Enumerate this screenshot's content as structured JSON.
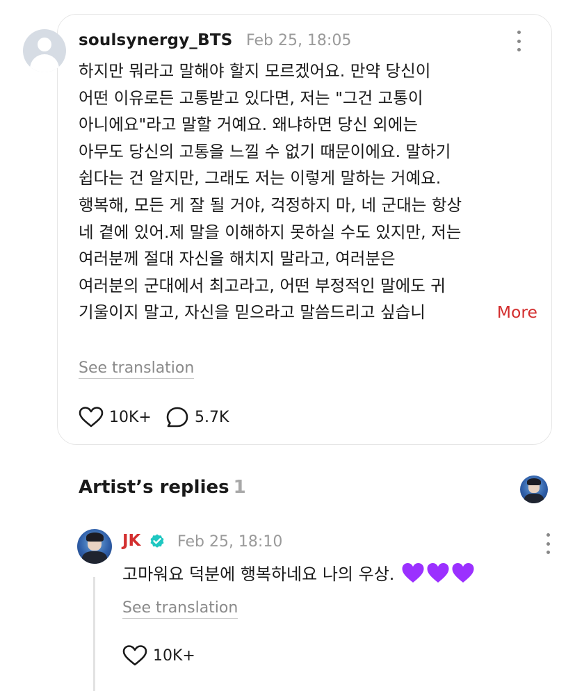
{
  "post": {
    "username": "soulsynergy_BTS",
    "timestamp": "Feb 25, 18:05",
    "lines": [
      "하지만 뭐라고 말해야 할지 모르겠어요. 만약 당신이",
      "어떤 이유로든 고통받고 있다면, 저는 \"그건 고통이",
      "아니에요\"라고 말할 거예요. 왜냐하면 당신 외에는",
      "아무도 당신의 고통을 느낄 수 없기 때문이에요. 말하기",
      "쉽다는 건 알지만, 그래도 저는 이렇게 말하는 거예요.",
      "행복해, 모든 게 잘 될 거야, 걱정하지 마, 네 군대는 항상",
      "네 곁에 있어.제 말을 이해하지 못하실 수도 있지만, 저는",
      "여러분께 절대 자신을 해치지 말라고, 여러분은",
      "여러분의 군대에서 최고라고, 어떤 부정적인 말에도 귀",
      "기울이지 말고, 자신을 믿으라고 말씀드리고 싶습니"
    ],
    "more_label": "More",
    "see_translation": "See translation",
    "likes": "10K+",
    "comments": "5.7K"
  },
  "replies_section": {
    "title": "Artist’s replies",
    "count": "1"
  },
  "reply": {
    "name": "JK",
    "timestamp": "Feb 25, 18:10",
    "text": "고마워요 덕분에 행복하네요 나의 우상.",
    "emoji_hearts": 3,
    "see_translation": "See translation",
    "likes": "10K+"
  },
  "colors": {
    "accent_red": "#d32f2f",
    "verified": "#1fc7c1",
    "heart_emoji": "#9b30ff"
  },
  "icons": {
    "avatar": "default-avatar-icon",
    "like": "heart-outline-icon",
    "comment": "speech-bubble-icon",
    "more": "kebab-menu-icon",
    "verified": "verified-badge-icon",
    "emoji": "purple-heart-emoji"
  }
}
